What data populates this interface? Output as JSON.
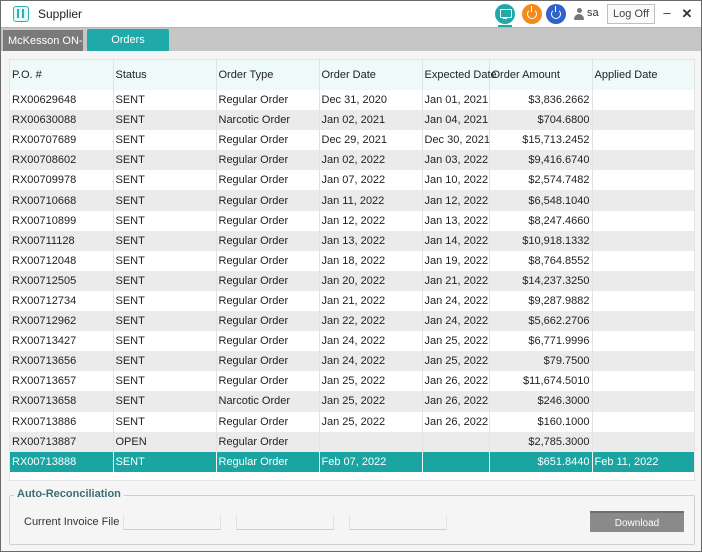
{
  "app": {
    "title": "Supplier",
    "user": "sa",
    "logoff_label": "Log Off",
    "minimize_label": "–",
    "close_label": "✕"
  },
  "colors": {
    "accent": "#1fa9a9",
    "selected_row": "#1aa5a3",
    "power_orange": "#f28a1c",
    "power_blue": "#2f63c9"
  },
  "icons": {
    "logo": "app-logo-icon",
    "monitor": "monitor-icon",
    "power_orange": "power-icon",
    "power_blue": "power-icon",
    "user": "user-icon"
  },
  "tabs": [
    {
      "label": "McKesson ON-F",
      "active": false
    },
    {
      "label": "Orders",
      "active": true
    }
  ],
  "table": {
    "columns": [
      "P.O. #",
      "Status",
      "Order Type",
      "Order Date",
      "Expected Date",
      "Order Amount",
      "Applied Date"
    ],
    "rows": [
      [
        "RX00629648",
        "SENT",
        "Regular Order",
        "Dec 31, 2020",
        "Jan 01, 2021",
        "$3,836.2662",
        ""
      ],
      [
        "RX00630088",
        "SENT",
        "Narcotic Order",
        "Jan 02, 2021",
        "Jan 04, 2021",
        "$704.6800",
        ""
      ],
      [
        "RX00707689",
        "SENT",
        "Regular Order",
        "Dec 29, 2021",
        "Dec 30, 2021",
        "$15,713.2452",
        ""
      ],
      [
        "RX00708602",
        "SENT",
        "Regular Order",
        "Jan 02, 2022",
        "Jan 03, 2022",
        "$9,416.6740",
        ""
      ],
      [
        "RX00709978",
        "SENT",
        "Regular Order",
        "Jan 07, 2022",
        "Jan 10, 2022",
        "$2,574.7482",
        ""
      ],
      [
        "RX00710668",
        "SENT",
        "Regular Order",
        "Jan 11, 2022",
        "Jan 12, 2022",
        "$6,548.1040",
        ""
      ],
      [
        "RX00710899",
        "SENT",
        "Regular Order",
        "Jan 12, 2022",
        "Jan 13, 2022",
        "$8,247.4660",
        ""
      ],
      [
        "RX00711128",
        "SENT",
        "Regular Order",
        "Jan 13, 2022",
        "Jan 14, 2022",
        "$10,918.1332",
        ""
      ],
      [
        "RX00712048",
        "SENT",
        "Regular Order",
        "Jan 18, 2022",
        "Jan 19, 2022",
        "$8,764.8552",
        ""
      ],
      [
        "RX00712505",
        "SENT",
        "Regular Order",
        "Jan 20, 2022",
        "Jan 21, 2022",
        "$14,237.3250",
        ""
      ],
      [
        "RX00712734",
        "SENT",
        "Regular Order",
        "Jan 21, 2022",
        "Jan 24, 2022",
        "$9,287.9882",
        ""
      ],
      [
        "RX00712962",
        "SENT",
        "Regular Order",
        "Jan 22, 2022",
        "Jan 24, 2022",
        "$5,662.2706",
        ""
      ],
      [
        "RX00713427",
        "SENT",
        "Regular Order",
        "Jan 24, 2022",
        "Jan 25, 2022",
        "$6,771.9996",
        ""
      ],
      [
        "RX00713656",
        "SENT",
        "Regular Order",
        "Jan 24, 2022",
        "Jan 25, 2022",
        "$79.7500",
        ""
      ],
      [
        "RX00713657",
        "SENT",
        "Regular Order",
        "Jan 25, 2022",
        "Jan 26, 2022",
        "$11,674.5010",
        ""
      ],
      [
        "RX00713658",
        "SENT",
        "Narcotic Order",
        "Jan 25, 2022",
        "Jan 26, 2022",
        "$246.3000",
        ""
      ],
      [
        "RX00713886",
        "SENT",
        "Regular Order",
        "Jan 25, 2022",
        "Jan 26, 2022",
        "$160.1000",
        ""
      ],
      [
        "RX00713887",
        "OPEN",
        "Regular Order",
        "",
        "",
        "$2,785.3000",
        ""
      ],
      [
        "RX00713888",
        "SENT",
        "Regular Order",
        "Feb 07, 2022",
        "",
        "$651.8440",
        "Feb 11, 2022"
      ]
    ],
    "selected_index": 18
  },
  "reconciliation": {
    "legend": "Auto-Reconciliation",
    "label": "Current Invoice File",
    "download_label": "Download"
  }
}
